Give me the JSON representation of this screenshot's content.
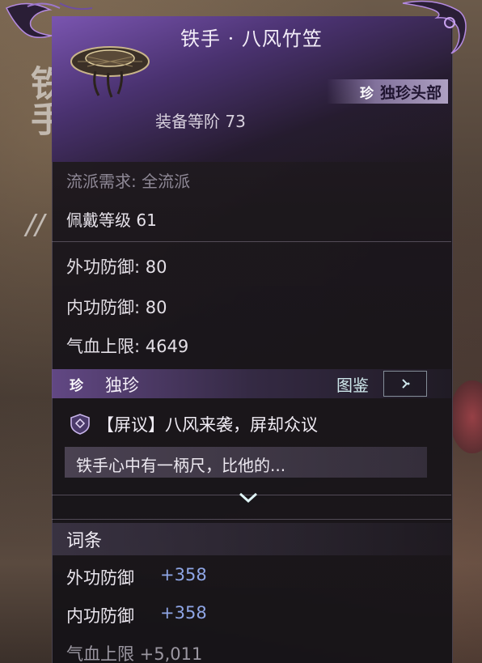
{
  "item": {
    "title": "铁手 · 八风竹笠",
    "rarity_badge": "珍",
    "rarity_label": "独珍头部",
    "equip_level": "装备等阶 73",
    "style_requirement": "流派需求: 全流派",
    "wear_level": "佩戴等级 61"
  },
  "base_stats": [
    {
      "label": "外功防御: 80"
    },
    {
      "label": "内功防御: 80"
    },
    {
      "label": "气血上限: 4649"
    }
  ],
  "unique_section": {
    "badge": "珍",
    "title": "独珍",
    "codex_label": "图鉴",
    "skill_name": "【屏议】八风来袭，屏却众议",
    "skill_desc": "铁手心中有一柄尺，比他的..."
  },
  "affix_section": {
    "title": "词条",
    "affixes": [
      {
        "name": "外功防御",
        "value": "+358"
      },
      {
        "name": "内功防御",
        "value": "+358"
      }
    ],
    "cutoff_text": "气血上限 +5,011"
  },
  "background": {
    "calligraphy": "铁手",
    "slash": "//"
  },
  "colors": {
    "accent_purple": "#7a55b0",
    "affix_value_blue": "#8fa6e6",
    "codex_cyan": "#cfe8ec"
  },
  "icons": [
    "bamboo-hat-icon",
    "shield-emblem-icon",
    "arrow-right-icon",
    "chevron-down-icon"
  ]
}
